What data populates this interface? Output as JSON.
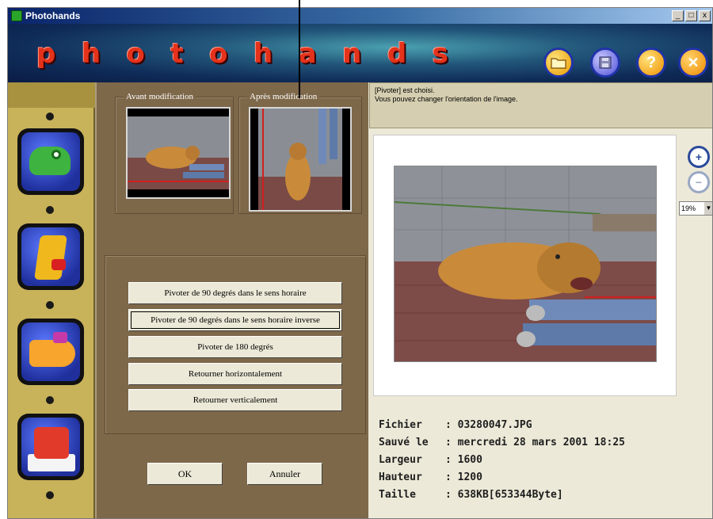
{
  "window": {
    "title": "Photohands",
    "controls": {
      "minimize": "_",
      "maximize": "□",
      "close": "x"
    }
  },
  "banner": {
    "letters": [
      "p",
      "h",
      "o",
      "t",
      "o",
      "h",
      "a",
      "n",
      "d",
      "s"
    ],
    "buttons": [
      {
        "name": "open-folder",
        "icon": "folder-icon"
      },
      {
        "name": "save",
        "icon": "disk-icon"
      },
      {
        "name": "help",
        "icon": "question-icon",
        "glyph": "?"
      },
      {
        "name": "exit",
        "icon": "close-icon",
        "glyph": "✕"
      }
    ]
  },
  "toolbar": {
    "tools": [
      {
        "name": "chameleon-tool",
        "icon": "chameleon-icon"
      },
      {
        "name": "giraffe-tool",
        "icon": "giraffe-icon"
      },
      {
        "name": "fish-tool",
        "icon": "fish-icon"
      },
      {
        "name": "bird-tool",
        "icon": "bird-icon"
      }
    ]
  },
  "rotate_panel": {
    "before_label": "Avant modification",
    "after_label": "Après modification",
    "actions": [
      "Pivoter de 90 degrés dans le sens horaire",
      "Pivoter de 90 degrés dans le sens horaire inverse",
      "Pivoter de 180 degrés",
      "Retourner horizontalement",
      "Retourner verticalement"
    ],
    "ok_label": "OK",
    "cancel_label": "Annuler"
  },
  "status": {
    "line1": "[Pivoter] est choisi.",
    "line2": "Vous pouvez changer l'orientation  de l'image."
  },
  "zoom": {
    "in_glyph": "+",
    "out_glyph": "−",
    "level": "19%"
  },
  "file_info": [
    {
      "key": "Fichier",
      "value": ": 03280047.JPG"
    },
    {
      "key": "Sauvé le",
      "value": ": mercredi 28 mars 2001 18:25"
    },
    {
      "key": "Largeur",
      "value": ": 1600"
    },
    {
      "key": "Hauteur",
      "value": ": 1200"
    },
    {
      "key": "Taille",
      "value": ": 638KB[653344Byte]"
    }
  ],
  "colors": {
    "title_bar": "#0a246a",
    "banner_letters": "#e4321b",
    "tool_strip": "#c8b25a",
    "center_panel": "#7e684a",
    "message_box": "#d5ceb0"
  }
}
